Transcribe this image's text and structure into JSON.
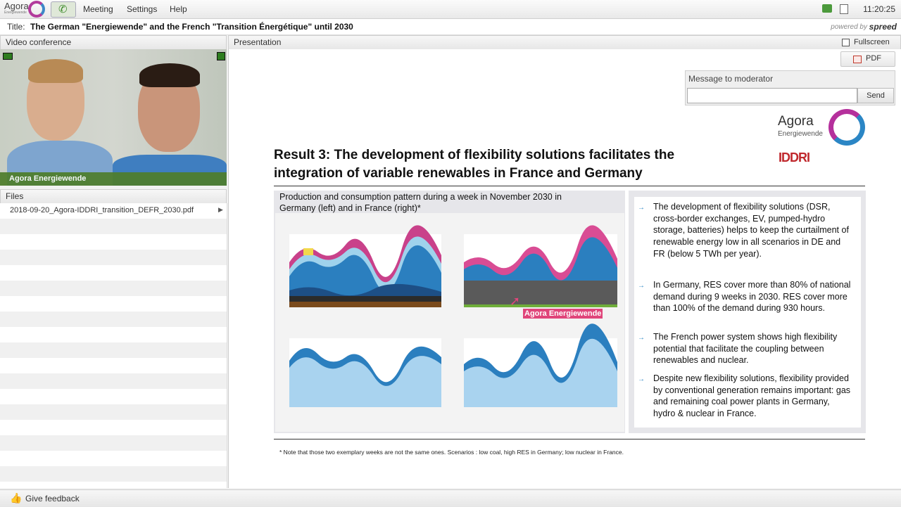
{
  "app": {
    "logo_text": "Agora",
    "logo_sub": "Energiewende",
    "menu": [
      "Meeting",
      "Settings",
      "Help"
    ],
    "clock": "11:20:25"
  },
  "titlebar": {
    "label": "Title:",
    "text": "The German \"Energiewende\" and the French \"Transition Énergétique\" until 2030",
    "powered_by": "powered by",
    "brand": "spreed"
  },
  "video": {
    "header": "Video conference",
    "caption": "Agora Energiewende"
  },
  "files": {
    "header": "Files",
    "items": [
      "2018-09-20_Agora-IDDRI_transition_DEFR_2030.pdf"
    ]
  },
  "presentation": {
    "header": "Presentation",
    "fullscreen_label": "Fullscreen",
    "pdf_label": "PDF",
    "moderator": {
      "label": "Message to moderator",
      "input_value": "",
      "send_label": "Send"
    }
  },
  "slide": {
    "title_line1": "Result 3: The development of flexibility solutions facilitates the",
    "title_line2": "integration of variable renewables in France and Germany",
    "agora_logo": "Agora",
    "agora_logo_sub": "Energiewende",
    "iddri_logo": "IDDRI",
    "charts_caption_line1": "Production and consumption pattern during a week in November 2030 in",
    "charts_caption_line2": "Germany (left) and in France (right)*",
    "bullets": [
      "The development of flexibility solutions (DSR, cross-border exchanges, EV, pumped-hydro storage, batteries) helps to keep the curtailment of renewable energy low in all scenarios in DE and FR (below 5 TWh per year).",
      "In Germany, RES cover more than 80% of national demand during 9 weeks in 2030. RES cover more than 100% of the demand during 930 hours.",
      "The French power system shows high flexibility potential that facilitate the coupling between renewables and nuclear.",
      "Despite new flexibility solutions, flexibility provided by conventional generation remains important: gas and remaining coal power plants in Germany, hydro & nuclear in France."
    ],
    "footnote": "* Note that those two exemplary weeks are not the same ones. Scenarios : low coal, high RES in Germany; low nuclear in France.",
    "pointer_label": "Agora Energiewende"
  },
  "feedback": {
    "label": "Give feedback"
  },
  "colors": {
    "accent_green": "#4e7d2b",
    "agora_magenta": "#b5309c",
    "agora_blue": "#2b86c5",
    "pointer_pink": "#e0457a"
  }
}
